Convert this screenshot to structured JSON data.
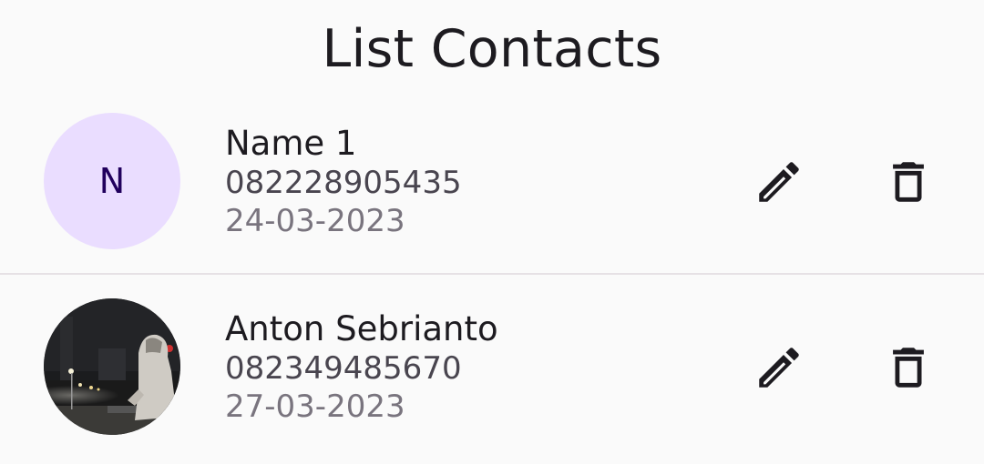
{
  "app_bar": {
    "title": "List Contacts"
  },
  "contacts": [
    {
      "avatar_initial": "N",
      "name": "Name 1",
      "phone": "082228905435",
      "date": "24-03-2023",
      "edit_icon": "pencil-icon",
      "delete_icon": "trash-icon"
    },
    {
      "avatar_photo": "person-in-hoodie-night-photo",
      "name": "Anton Sebrianto",
      "phone": "082349485670",
      "date": "27-03-2023",
      "edit_icon": "pencil-icon",
      "delete_icon": "trash-icon"
    }
  ],
  "colors": {
    "background": "#fafafa",
    "avatar_bg": "#eaddff",
    "avatar_text": "#21005d",
    "primary_text": "#1d1b20",
    "secondary_text": "#49454f",
    "tertiary_text": "#79747e",
    "divider": "#e6e1e5"
  }
}
